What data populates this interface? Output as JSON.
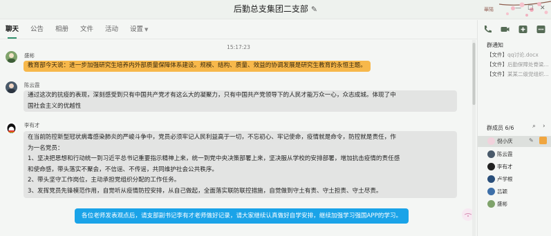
{
  "window": {
    "title": "后勤总支集团二支部",
    "user_name": "華陽"
  },
  "tabs": [
    {
      "label": "聊天"
    },
    {
      "label": "公告"
    },
    {
      "label": "相册"
    },
    {
      "label": "文件"
    },
    {
      "label": "活动"
    },
    {
      "label": "设置"
    }
  ],
  "chat": {
    "timestamp": "15:17:23",
    "messages": [
      {
        "sender": "盛彬",
        "lines": [
          "教育部今天说：进一步加强研究生培养内外部质量保障体系建设。规模、结构、质量、效益的协调发展是研究生教育的永恒主题。"
        ],
        "color": "#f7b84b"
      },
      {
        "sender": "陈云霞",
        "lines": [
          "通过这次的抗疫的表现，深刻感受到只有中国共产党才有这么大的凝聚力，只有中国共产党领导下的人民才能万众一心，众志成城。体现了中",
          "国社会主义的优越性"
        ]
      },
      {
        "sender": "李有才",
        "lines": [
          "在当前防控新型冠状病毒感染肺炎的严峻斗争中，党员必须牢记人民利益高于一切，不忘初心、牢记使命，疫情就是命令，防控就是责任，作",
          "为一名党员：",
          "1、坚决把思想和行动统一到习近平总书记重要指示精神上来，统一到党中央决策部署上来，坚决服从学校的安排部署，增加抗击疫情的责任感",
          "和使命感，带头落实不聚会，不信谣、不传谣，共同维护社会公共秩序。",
          "2、带头坚守工作岗位，主动承担党组织分配的工作任务。",
          "3、发挥党员先锋模范作用，自觉听从疫情防控安排，从自己做起，全面落实联防联控措施，自觉做到守土有责、守土担责、守土尽责。"
        ]
      },
      {
        "sender": "",
        "lines": [
          "各位老师发表观点后，请支部副书记李有才老师做好记录，请大家继续认真做好自学安排，继续加强学习强国APP的学习。"
        ],
        "color": "#1aa3e8"
      }
    ]
  },
  "sidebar": {
    "notice_title": "群通知",
    "notices": [
      {
        "tag": "【文件】",
        "text": "qq讨论.docx"
      },
      {
        "tag": "【文件】",
        "text": "后勤保障处脊梁..."
      },
      {
        "tag": "【文件】",
        "text": "某某二级党组织..."
      }
    ],
    "members_title": "群成员 6/6",
    "members": [
      {
        "name": "倪小庆",
        "selected": true
      },
      {
        "name": "陈云霞"
      },
      {
        "name": "李有才"
      },
      {
        "name": "卢学根"
      },
      {
        "name": "吕颖"
      },
      {
        "name": "盛彬"
      }
    ]
  }
}
